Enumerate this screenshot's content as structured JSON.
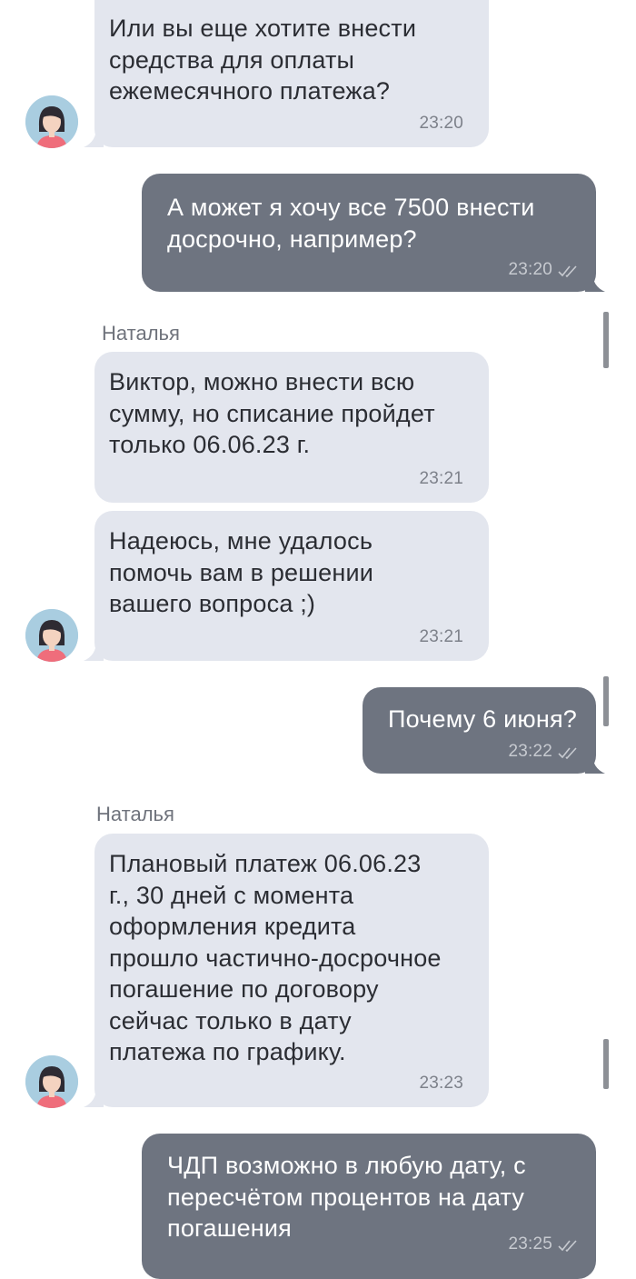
{
  "messages": [
    {
      "text": "Или вы еще хотите внести\nсредства для оплаты\nежемесячного платежа?",
      "time": "23:20"
    },
    {
      "text": "А может я хочу все 7500 внести\nдосрочно, например?",
      "time": "23:20"
    },
    {
      "sender": "Наталья",
      "text": "Виктор, можно внести всю\nсумму, но списание пройдет\nтолько 06.06.23 г.",
      "time": "23:21"
    },
    {
      "text": "Надеюсь, мне удалось\nпомочь вам в решении\nвашего вопроса ;)",
      "time": "23:21"
    },
    {
      "text": "Почему 6 июня?",
      "time": "23:22"
    },
    {
      "sender": "Наталья",
      "text": "Плановый платеж 06.06.23\nг., 30 дней с момента\nоформления кредита\nпрошло частично-досрочное\nпогашение по договору\nсейчас только в дату\nплатежа по графику.",
      "time": "23:23"
    },
    {
      "text": "ЧДП возможно в любую дату, с\nпересчётом процентов на дату\nпогашения",
      "time": "23:25"
    }
  ],
  "colors": {
    "incoming_bubble": "#e3e6ee",
    "outgoing_bubble": "#6e7480",
    "incoming_text": "#2b2d33",
    "outgoing_text": "#ffffff"
  },
  "icons": [
    "agent-avatar",
    "double-check-icon"
  ]
}
